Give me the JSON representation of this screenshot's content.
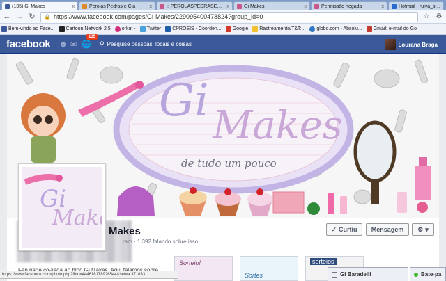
{
  "browser": {
    "tabs": [
      {
        "label": "(135) Gi Makes",
        "icon_color": "#3b5998",
        "active": true
      },
      {
        "label": "Perolas Pedras e Cia",
        "icon_color": "#e08a2a",
        "active": false
      },
      {
        "label": ":: PEROLASPEDRASECIA",
        "icon_color": "#c9578b",
        "active": false
      },
      {
        "label": "Gi Makes",
        "icon_color": "#c9578b",
        "active": false
      },
      {
        "label": "Permissão negada",
        "icon_color": "#c9578b",
        "active": false
      },
      {
        "label": "Hotmail - ruiva_sape",
        "icon_color": "#2a6bd0",
        "active": false
      }
    ],
    "tab_close": "x",
    "url": "https://www.facebook.com/pages/Gi-Makes/229095400478824?group_id=0",
    "bookmarks": [
      {
        "label": "Bem-vindo ao Face...",
        "icon_color": "#3b5998"
      },
      {
        "label": "Cartoon Network 2.5",
        "icon_color": "#222222"
      },
      {
        "label": "orkut -",
        "icon_color": "#d1307a"
      },
      {
        "label": "Twitter",
        "icon_color": "#4aa3df"
      },
      {
        "label": "CPROEIS - Coorden...",
        "icon_color": "#1f5fa8"
      },
      {
        "label": "Google",
        "icon_color": "#d23a2c"
      },
      {
        "label": "Rastreamento/T&T:...",
        "icon_color": "#f2c230"
      },
      {
        "label": "globo.com - Absolu...",
        "icon_color": "#2f77c2"
      },
      {
        "label": "Gmail: e-mail do Go",
        "icon_color": "#c43b2f"
      }
    ],
    "status_url": "https://www.facebook.com/photo.php?fbid=444618178926544&set=a.371633..."
  },
  "facebook": {
    "logo": "facebook",
    "notif_count": "135",
    "search_placeholder": "Pesquise pessoas, locais e coisas",
    "user_name": "Lourana Braga"
  },
  "cover": {
    "brand_gi": "Gi",
    "brand_makes": "Makes",
    "tagline": "de tudo um pouco"
  },
  "page": {
    "name": "Makes",
    "stats": "ram · 1.392 falando sobre isso",
    "like_button": "Curtiu",
    "message_button": "Mensagem",
    "description": "Fan page co-liada ao blog Gi Makes. Aqui falamos sobre",
    "apps": [
      {
        "label": "Sorteio!",
        "bg": "#f3e7f3"
      },
      {
        "label": "Sortes",
        "bg": "#eaf4fb"
      },
      {
        "label": "sorteios",
        "bg": "#f3f3f3"
      }
    ]
  },
  "chat": {
    "friend": "Gi Baradelli",
    "sidebar_label": "Bate-pa"
  },
  "colors": {
    "fb_blue": "#3b5998",
    "lavender": "#b7a6dd",
    "pink": "#e86aa6"
  }
}
